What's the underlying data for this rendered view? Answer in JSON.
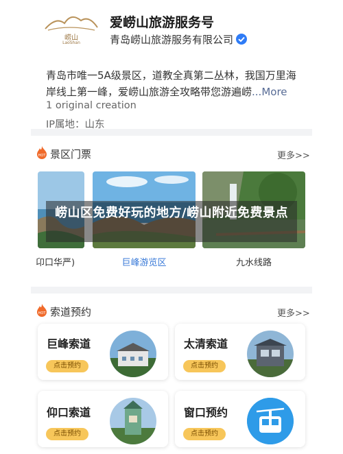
{
  "account": {
    "logo_text": "崂山",
    "logo_subtext": "LaoShan",
    "name": "爱崂山旅游服务号",
    "company": "青岛崂山旅游服务有限公司"
  },
  "description": {
    "text": "青岛市唯一5A级景区，道教全真第二丛林，我国万里海岸线上第一峰，爱崂山旅游全攻略带您游遍崂",
    "ellipsis_more": "...More"
  },
  "original_count": "1 original creation",
  "ip_location": "IP属地：山东",
  "overlay_title": "崂山区免费好玩的地方/崂山附近免费景点",
  "tickets_section": {
    "title": "景区门票",
    "more": "更多>>",
    "hot_badge": "HOT",
    "items": [
      {
        "caption": "卬口华严)"
      },
      {
        "caption": "巨峰游览区"
      },
      {
        "caption": "九水线路"
      }
    ]
  },
  "cableway_section": {
    "title": "索道预约",
    "more": "更多>>",
    "hot_badge": "HOT",
    "items": [
      {
        "name": "巨峰索道",
        "button": "点击预约"
      },
      {
        "name": "太清索道",
        "button": "点击预约"
      },
      {
        "name": "仰口索道",
        "button": "点击预约"
      },
      {
        "name": "窗口预约",
        "button": "点击预约"
      }
    ]
  },
  "colors": {
    "verified_blue": "#2f7cf6",
    "link_blue": "#576b95",
    "active_caption": "#3b7bd8",
    "button_yellow": "#f7c65a",
    "hot_orange": "#f06a2a"
  }
}
